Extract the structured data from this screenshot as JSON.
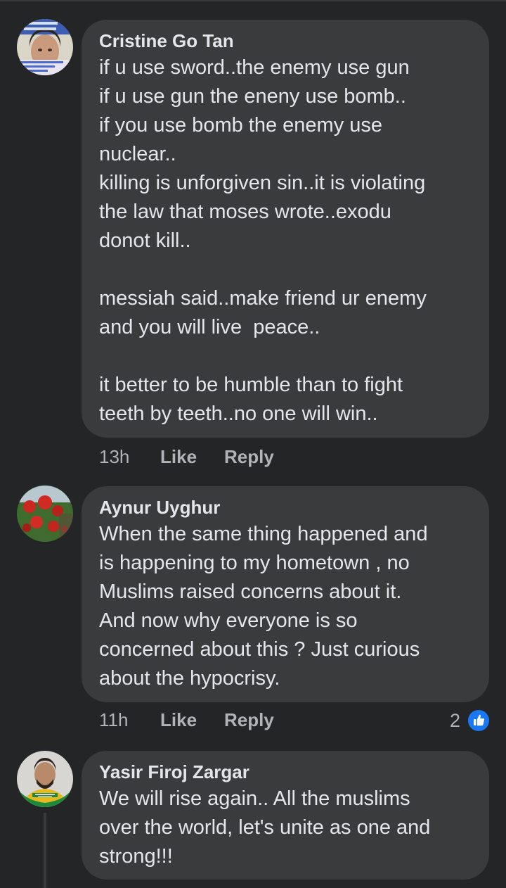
{
  "comments": [
    {
      "author": "Cristine Go Tan",
      "avatar_icon": "profile-photo-woman-with-text-overlay",
      "avatar_text_top": "Walk with the wise and become wise",
      "avatar_text_bottom": "for a companion of fools suffers harm",
      "text": "if u use sword..the enemy use gun\nif u use gun the eneny use bomb..\nif you use bomb the enemy use\nnuclear..\nkilling is unforgiven sin..it is violating\nthe law that moses wrote..exodu\ndonot kill..\n\nmessiah said..make friend ur enemy\nand you will live  peace..\n\nit better to be humble than to fight\nteeth by teeth..no one will win..",
      "time": "13h",
      "like_label": "Like",
      "reply_label": "Reply"
    },
    {
      "author": "Aynur Uyghur",
      "avatar_icon": "profile-photo-red-flowers",
      "text": "When the same thing happened and\nis happening to my hometown , no\nMuslims raised concerns about it.\nAnd now why everyone is so\nconcerned about this ? Just curious\nabout the hypocrisy.",
      "time": "11h",
      "like_label": "Like",
      "reply_label": "Reply",
      "reaction_count": "2",
      "reaction_icon": "thumbs-up-icon"
    },
    {
      "author": "Yasir Firoj Zargar",
      "avatar_icon": "profile-photo-man-solidarity-frame",
      "avatar_frame_text": "Solidarity With Palestine",
      "text": "We will rise again.. All the muslims\nover the world, let's unite as one and\nstrong!!!"
    }
  ],
  "colors": {
    "background": "#242526",
    "bubble": "#3a3b3c",
    "text": "#e4e6eb",
    "secondary_text": "#b0b3b8",
    "like_blue": "#1877f2"
  }
}
